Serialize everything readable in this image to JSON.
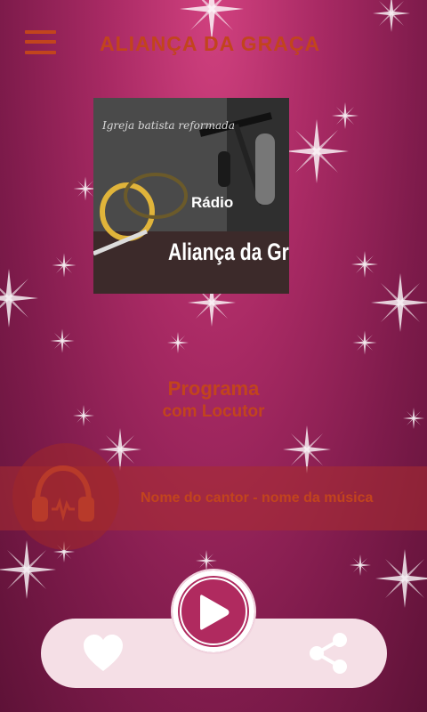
{
  "header": {
    "title": "ALIANÇA DA GRAÇA",
    "menu_icon": "hamburger-icon"
  },
  "cover": {
    "script_text": "Igreja batista reformada",
    "radio_text": "Rádio",
    "name_text": "Aliança da Gra"
  },
  "program": {
    "title": "Programa",
    "subtitle": "com Locutor"
  },
  "now_playing": {
    "text": "Nome do cantor - nome da música",
    "icon": "headphones-icon"
  },
  "controls": {
    "like_icon": "heart-icon",
    "play_icon": "play-icon",
    "share_icon": "share-icon"
  },
  "colors": {
    "accent": "#c2441d",
    "background": "#a92a64",
    "panel": "#f5dfe6"
  }
}
